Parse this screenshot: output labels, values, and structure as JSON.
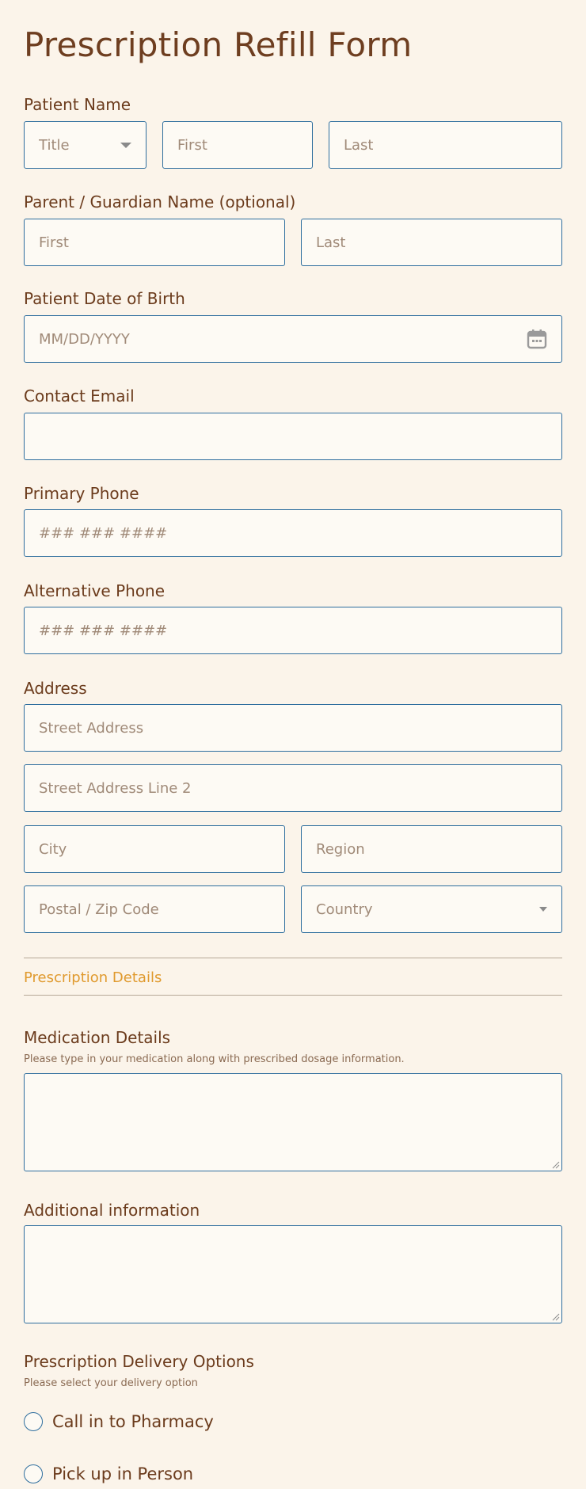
{
  "form": {
    "title": "Prescription Refill Form"
  },
  "patient_name": {
    "label": "Patient Name",
    "title_placeholder": "Title",
    "first_placeholder": "First",
    "last_placeholder": "Last"
  },
  "guardian_name": {
    "label": "Parent / Guardian Name (optional)",
    "first_placeholder": "First",
    "last_placeholder": "Last"
  },
  "dob": {
    "label": "Patient Date of Birth",
    "placeholder": "MM/DD/YYYY",
    "icon": "calendar-icon"
  },
  "email": {
    "label": "Contact Email",
    "placeholder": ""
  },
  "primary_phone": {
    "label": "Primary Phone",
    "placeholder": "### ### ####"
  },
  "alt_phone": {
    "label": "Alternative Phone",
    "placeholder": "### ### ####"
  },
  "address": {
    "label": "Address",
    "street_placeholder": "Street Address",
    "street2_placeholder": "Street Address Line 2",
    "city_placeholder": "City",
    "region_placeholder": "Region",
    "postal_placeholder": "Postal / Zip Code",
    "country_placeholder": "Country"
  },
  "section": {
    "title": "Prescription Details"
  },
  "medication": {
    "label": "Medication Details",
    "sublabel": "Please type in your medication along with prescribed dosage information."
  },
  "additional": {
    "label": "Additional information"
  },
  "delivery": {
    "label": "Prescription Delivery Options",
    "sublabel": "Please select your delivery option",
    "options": [
      "Call in to Pharmacy",
      "Pick up in Person"
    ]
  },
  "colors": {
    "background": "#fbf4ea",
    "text": "#6b3b1c",
    "border": "#2e6e9e",
    "accent": "#e09a2e"
  }
}
